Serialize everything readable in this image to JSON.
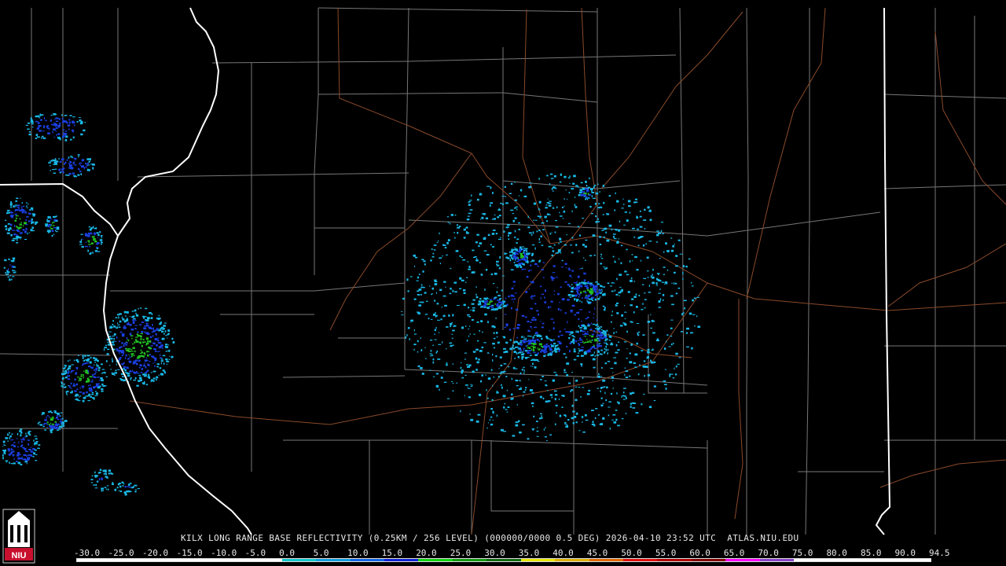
{
  "caption": "KILX LONG RANGE BASE REFLECTIVITY (0.25KM / 256 LEVEL) (000000/0000 0.5 DEG) 2026-04-10 23:52 UTC  ATLAS.NIU.EDU",
  "scale": {
    "ticks": [
      "-30.0",
      "-25.0",
      "-20.0",
      "-15.0",
      "-10.0",
      "-5.0",
      "0.0",
      "5.0",
      "10.0",
      "15.0",
      "20.0",
      "25.0",
      "30.0",
      "35.0",
      "40.0",
      "45.0",
      "50.0",
      "55.0",
      "60.0",
      "65.0",
      "70.0",
      "75.0",
      "80.0",
      "85.0",
      "90.0",
      "94.5"
    ],
    "colors": [
      "#ffffff",
      "#ffffff",
      "#ffffff",
      "#ffffff",
      "#ffffff",
      "#ffffff",
      "#11c8cc",
      "#119ee0",
      "#1166e8",
      "#1122d8",
      "#11d411",
      "#119a11",
      "#106a10",
      "#e8e800",
      "#e0b000",
      "#e06800",
      "#e01010",
      "#b00000",
      "#800000",
      "#ff00ff",
      "#8844cc",
      "#ffffff",
      "#ffffff",
      "#ffffff",
      "#ffffff"
    ]
  },
  "logo": {
    "text": "NIU"
  },
  "colors": {
    "county_lines": "#7a7a7a",
    "roads": "#8a4a2a",
    "state_border": "#ffffff",
    "light_echo": "#19b8e6",
    "moderate_echo": "#1a3fe0",
    "strong_echo": "#22c022"
  }
}
